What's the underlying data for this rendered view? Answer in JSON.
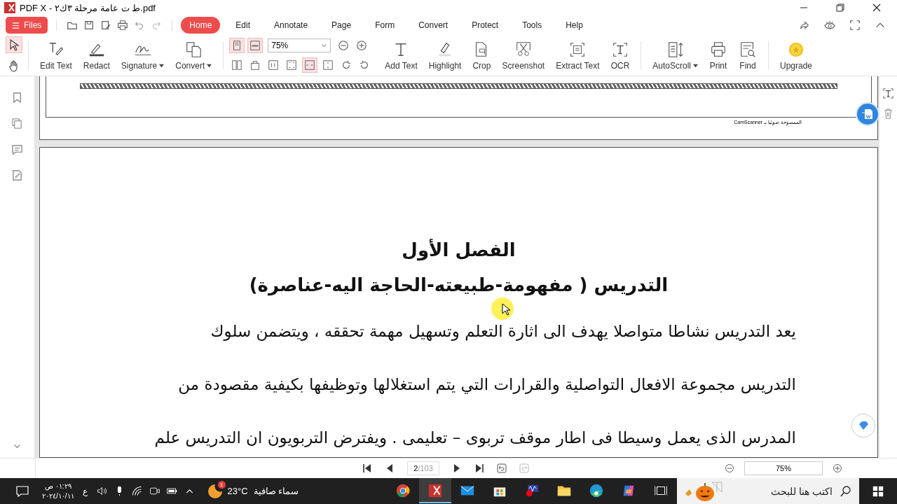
{
  "window": {
    "title": "PDF X - ط ت عامة مرحلة ٣ك٢.pdf"
  },
  "files_button": {
    "label": "Files"
  },
  "menu_tabs": [
    {
      "label": "Home",
      "selected": true
    },
    {
      "label": "Edit",
      "selected": false
    },
    {
      "label": "Annotate",
      "selected": false
    },
    {
      "label": "Page",
      "selected": false
    },
    {
      "label": "Form",
      "selected": false
    },
    {
      "label": "Convert",
      "selected": false
    },
    {
      "label": "Protect",
      "selected": false
    },
    {
      "label": "Tools",
      "selected": false
    },
    {
      "label": "Help",
      "selected": false
    }
  ],
  "pointer_tools": [
    {
      "selected": true
    },
    {
      "selected": false
    }
  ],
  "tools_left": [
    {
      "label": "Edit Text",
      "kind": "button"
    },
    {
      "label": "Redact",
      "kind": "button"
    },
    {
      "label": "Signature",
      "kind": "dropdown"
    },
    {
      "label": "Convert",
      "kind": "dropdown"
    }
  ],
  "view_modes": [
    {
      "selected": true
    },
    {
      "selected": true
    }
  ],
  "zoom_select": {
    "value": "75%"
  },
  "fit_modes": [
    {
      "selected": false
    },
    {
      "selected": false
    },
    {
      "selected": true
    },
    {
      "selected": false
    }
  ],
  "tools_right": [
    {
      "label": "Add Text",
      "kind": "button"
    },
    {
      "label": "Highlight",
      "kind": "button"
    },
    {
      "label": "Crop",
      "kind": "button"
    },
    {
      "label": "Screenshot",
      "kind": "button"
    },
    {
      "label": "Extract Text",
      "kind": "button"
    },
    {
      "label": "OCR",
      "kind": "button"
    },
    {
      "label": "AutoScroll",
      "kind": "dropdown"
    },
    {
      "label": "Print",
      "kind": "button"
    },
    {
      "label": "Find",
      "kind": "button"
    },
    {
      "label": "Upgrade",
      "kind": "button"
    }
  ],
  "document": {
    "footer_note": "الممسوحة ضوئيا بـ CamScanner",
    "heading": "الفصل الأول",
    "subtitle": "التدريس ( مفهومة-طبيعته-الحاجة اليه-عناصرة)",
    "lines": [
      "يعد التدريس نشاطا متواصلا يهدف الى اثارة التعلم وتسهيل مهمة تحققه ، ويتضمن سلوك",
      "التدريس مجموعة الافعال التواصلية والقرارات التي يتم استغلالها وتوظيفها بكيفية مقصودة من",
      "المدرس الذى يعمل وسيطا فى اطار موقف تربوى – تعليمى . ويفترض التربويون ان التدريس علم"
    ]
  },
  "navigation": {
    "page": "2",
    "total": "/103",
    "zoom": "75%"
  },
  "taskbar": {
    "search_placeholder": "اكتب هنا للبحث",
    "weather_condition": "سماء صافية",
    "temperature": "23°C",
    "weather_badge": "1",
    "language": "ع",
    "time": "٠١:٢٩ ص",
    "date": "٢٠٢٤/١٠/١١"
  }
}
